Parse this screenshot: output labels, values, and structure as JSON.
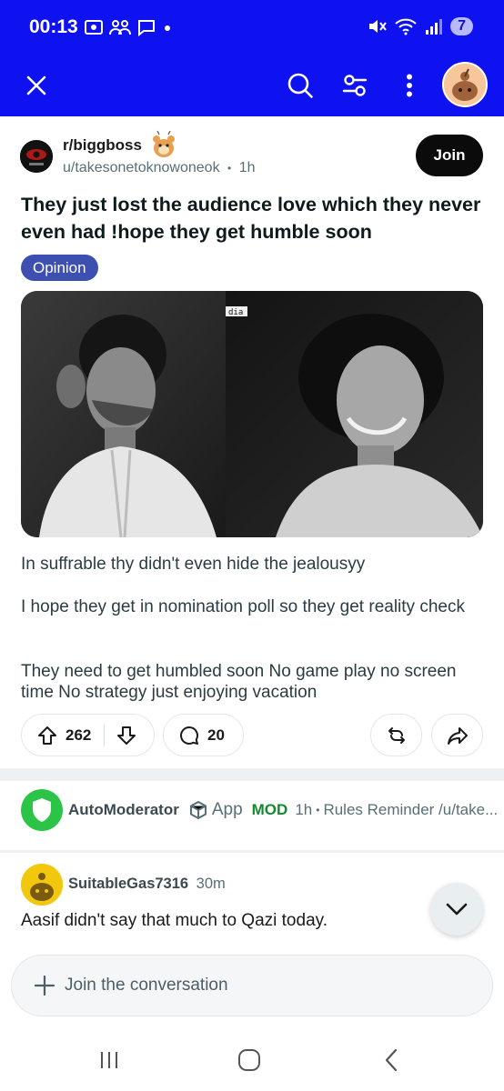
{
  "status_bar": {
    "time": "00:13",
    "notification_count": "7"
  },
  "header": {
    "close_icon": "close-icon",
    "search_icon": "search-icon",
    "filter_icon": "sort-filter-icon",
    "more_icon": "more-vertical-icon"
  },
  "post": {
    "subreddit": "r/biggboss",
    "author": "u/takesonetoknowoneok",
    "separator": "•",
    "age": "1h",
    "join_label": "Join",
    "title": "They just lost the audience love which they never even had !hope they get humble soon",
    "flair": "Opinion",
    "image_watermark": "dia",
    "body": [
      "In suffrable thy didn't even hide the jealousyy",
      "I hope they get in nomination poll so they get reality check",
      "They need to get humbled soon No game play no screen time No strategy just enjoying vacation"
    ],
    "upvotes": "262",
    "comments": "20"
  },
  "automod": {
    "name": "AutoModerator",
    "app_label": "App",
    "mod_label": "MOD",
    "age": "1h",
    "separator": "•",
    "preview": "Rules Reminder /u/take..."
  },
  "comment": {
    "user": "SuitableGas7316",
    "age": "30m",
    "text": "Aasif didn't say that much to Qazi today."
  },
  "composer": {
    "placeholder": "Join the conversation"
  },
  "colors": {
    "header_bg": "#0e12f0",
    "flair_bg": "#3d4fb0",
    "mod_green": "#128a2e",
    "join_bg": "#0b0b0b"
  }
}
